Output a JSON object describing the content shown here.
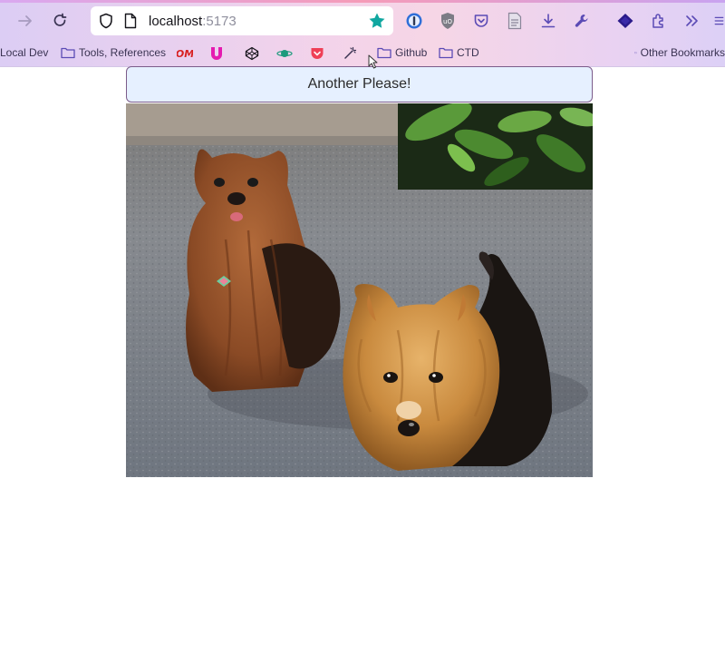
{
  "browser": {
    "url_host": "localhost",
    "url_port": ":5173",
    "toolbar_icons": [
      "forward-icon",
      "reload-icon",
      "shield-icon",
      "page-icon",
      "bookmark-star-icon",
      "1password-icon",
      "ublock-icon",
      "pocket-icon",
      "reader-icon",
      "download-icon",
      "wrench-icon",
      "layers-icon",
      "extensions-icon",
      "overflow-icon",
      "menu-icon"
    ],
    "star_color": "#10a7a0",
    "bookmarks": [
      {
        "label": "Local Dev",
        "type": "folder-cut"
      },
      {
        "label": "Tools, References",
        "type": "folder"
      },
      {
        "label": "",
        "type": "favicon",
        "icon": "om-favicon-icon"
      },
      {
        "label": "",
        "type": "favicon",
        "icon": "u-favicon-icon"
      },
      {
        "label": "",
        "type": "favicon",
        "icon": "codepen-favicon-icon"
      },
      {
        "label": "",
        "type": "favicon",
        "icon": "planet-favicon-icon"
      },
      {
        "label": "",
        "type": "favicon",
        "icon": "pocket-favicon-icon"
      },
      {
        "label": "",
        "type": "favicon",
        "icon": "magic-wand-favicon-icon"
      },
      {
        "label": "Github",
        "type": "folder"
      },
      {
        "label": "CTD",
        "type": "folder"
      },
      {
        "label": "Other Bookmarks",
        "type": "folder"
      }
    ]
  },
  "page": {
    "button_label": "Another Please!",
    "image_subject": "two yorkshire terriers on gravel"
  }
}
